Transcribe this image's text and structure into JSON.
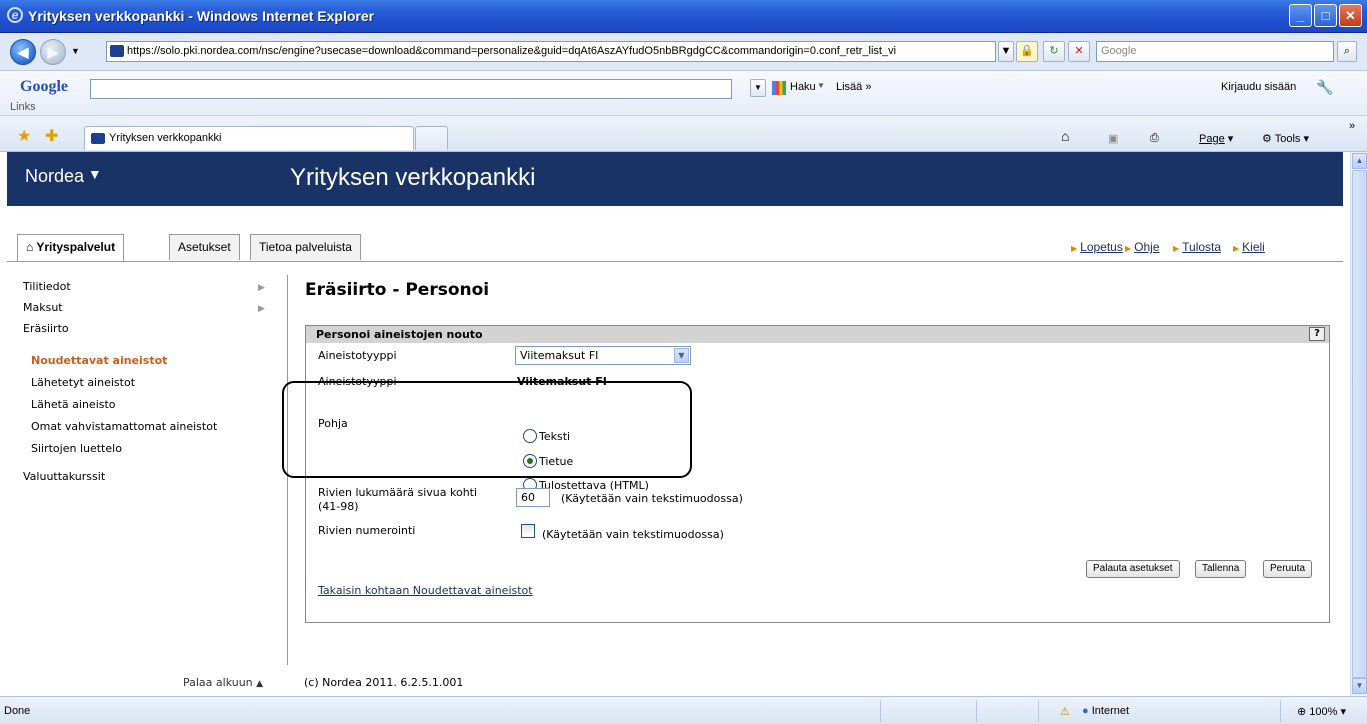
{
  "window": {
    "title": "Yrityksen verkkopankki - Windows Internet Explorer"
  },
  "address": {
    "url": "https://solo.pki.nordea.com/nsc/engine?usecase=download&command=personalize&guid=dqAt6AszAYfudO5nbBRgdgCC&commandorigin=0.conf_retr_list_vi",
    "search_placeholder": "Google"
  },
  "google_toolbar": {
    "logo": "Google",
    "search_label": "Haku",
    "more_label": "Lisää »",
    "signin_label": "Kirjaudu sisään",
    "links_label": "Links"
  },
  "tabs": {
    "active_tab": "Yrityksen verkkopankki"
  },
  "command_bar": {
    "page_label": "Page",
    "tools_label": "Tools"
  },
  "site": {
    "logo": "Nordea",
    "app_title": "Yrityksen verkkopankki",
    "nav_tabs": [
      "Yrityspalvelut",
      "Asetukset",
      "Tietoa palveluista"
    ],
    "top_links": [
      "Lopetus",
      "Ohje",
      "Tulosta",
      "Kieli"
    ]
  },
  "sidebar": {
    "items": [
      "Tilitiedot",
      "Maksut",
      "Eräsiirto"
    ],
    "subitems": [
      "Noudettavat aineistot",
      "Lähetetyt aineistot",
      "Lähetä aineisto",
      "Omat vahvistamattomat aineistot",
      "Siirtojen luettelo"
    ],
    "extra_item": "Valuuttakurssit",
    "back_to_top": "Palaa alkuun"
  },
  "main": {
    "heading": "Eräsiirto - Personoi",
    "panel_title": "Personoi aineistojen nouto",
    "help": "?",
    "type_label": "Aineistotyyppi",
    "type_select_value": "Viitemaksut FI",
    "type_label_2": "Aineistotyyppi",
    "type_value": "Viitemaksut FI",
    "base_label": "Pohja",
    "radio_options": [
      "Teksti",
      "Tietue",
      "Tulostettava (HTML)"
    ],
    "selected_radio": "Tietue",
    "rows_label_1": "Rivien lukumäärä sivua kohti",
    "rows_label_2": "(41-98)",
    "rows_value": "60",
    "rows_note": "(Käytetään vain tekstimuodossa)",
    "numbering_label": "Rivien numerointi",
    "numbering_checked": false,
    "numbering_note": "(Käytetään vain tekstimuodossa)",
    "buttons": [
      "Palauta asetukset",
      "Tallenna",
      "Peruuta"
    ],
    "back_link": "Takaisin kohtaan Noudettavat aineistot"
  },
  "footer": {
    "copyright": "(c) Nordea 2011. 6.2.5.1.001"
  },
  "statusbar": {
    "status": "Done",
    "zone": "Internet",
    "zoom": "100%"
  }
}
